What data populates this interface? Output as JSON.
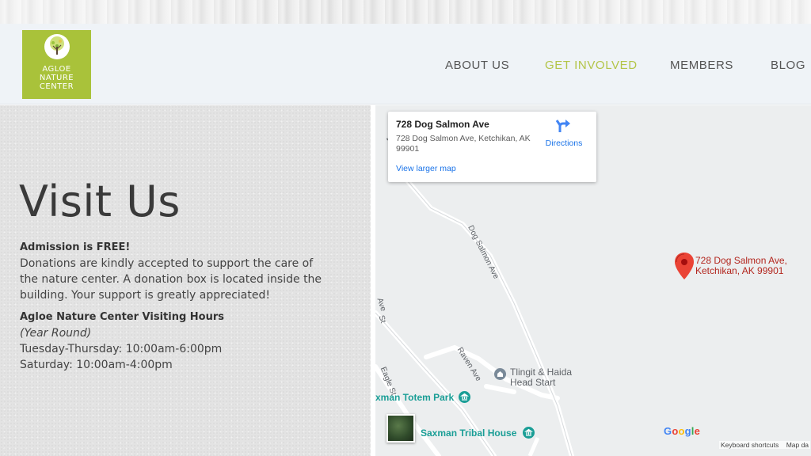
{
  "logo": {
    "text": "AGLOE\nNATURE\nCENTER"
  },
  "nav": {
    "items": [
      "ABOUT US",
      "GET INVOLVED",
      "MEMBERS",
      "BLOG"
    ],
    "active": "GET INVOLVED"
  },
  "page": {
    "title": "Visit Us",
    "admission_heading": "Admission is FREE!",
    "admission_lines": [
      "Donations are kindly accepted to support the care of",
      "the nature center. A donation box is located inside the",
      "building. Your support is greatly appreciated!"
    ],
    "hours_heading": "Agloe Nature Center Visiting Hours",
    "hours_note": "(Year Round)",
    "hours_lines": [
      "Tuesday-Thursday:  10:00am-6:00pm",
      "Saturday:  10:00am-4:00pm"
    ]
  },
  "map": {
    "card": {
      "title": "728 Dog Salmon Ave",
      "address": "728 Dog Salmon Ave, Ketchikan, AK 99901",
      "directions": "Directions",
      "larger_map": "View larger map"
    },
    "pin_label_line1": "728 Dog Salmon Ave,",
    "pin_label_line2": "Ketchikan, AK 99901",
    "streets": {
      "dog_salmon": "Dog Salmon Ave",
      "raven": "Raven Ave",
      "eagle": "Eagle St",
      "ave_top": "Ave",
      "ave_left": "Ave",
      "st_left": "St"
    },
    "pois": {
      "tlingit_line1": "Tlingit & Haida",
      "tlingit_line2": "Head Start",
      "totem_park": "xman Totem Park",
      "tribal_house": "Saxman Tribal House"
    },
    "google": "Google",
    "keyboard_shortcuts": "Keyboard shortcuts",
    "map_data": "Map da",
    "colors": {
      "poi_teal": "#1a9e96",
      "poi_gray": "#7a8a99",
      "pin_red": "#ea4335",
      "brand_green": "#a9c23a"
    }
  }
}
